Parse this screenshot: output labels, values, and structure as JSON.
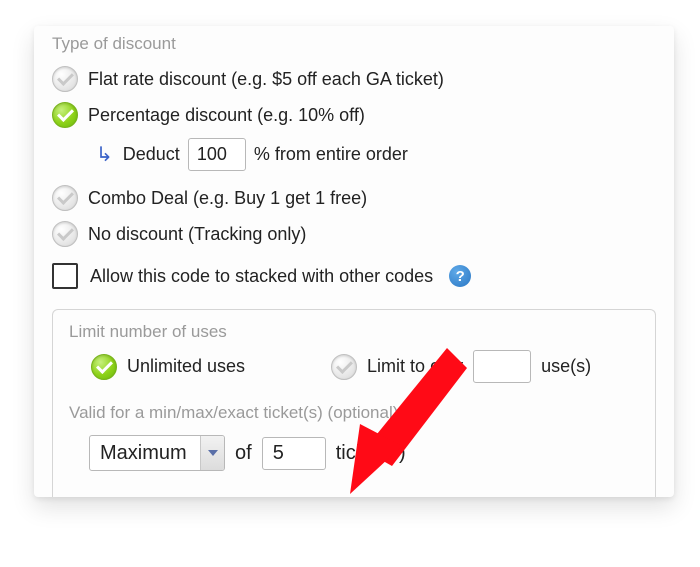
{
  "section": {
    "title": "Type of discount",
    "options": {
      "flat": {
        "label": "Flat rate discount (e.g. $5 off each GA ticket)",
        "selected": false
      },
      "percent": {
        "label": "Percentage discount (e.g. 10% off)",
        "selected": true
      },
      "combo": {
        "label": "Combo Deal (e.g. Buy 1 get 1 free)",
        "selected": false
      },
      "none": {
        "label": "No discount (Tracking only)",
        "selected": false
      }
    },
    "percent_sub": {
      "deduct_label": "Deduct",
      "value": "100",
      "suffix": "% from entire order"
    },
    "stack": {
      "label": "Allow this code to stacked with other codes",
      "help_glyph": "?"
    }
  },
  "limits": {
    "title": "Limit number of uses",
    "unlimited": {
      "label": "Unlimited uses",
      "selected": true
    },
    "limited": {
      "prefix": "Limit to only",
      "value": "",
      "suffix": "use(s)",
      "selected": false
    }
  },
  "valid": {
    "title": "Valid for a min/max/exact ticket(s) (optional)",
    "mode": "Maximum",
    "of_label": "of",
    "count": "5",
    "suffix": "ticket(s)"
  }
}
